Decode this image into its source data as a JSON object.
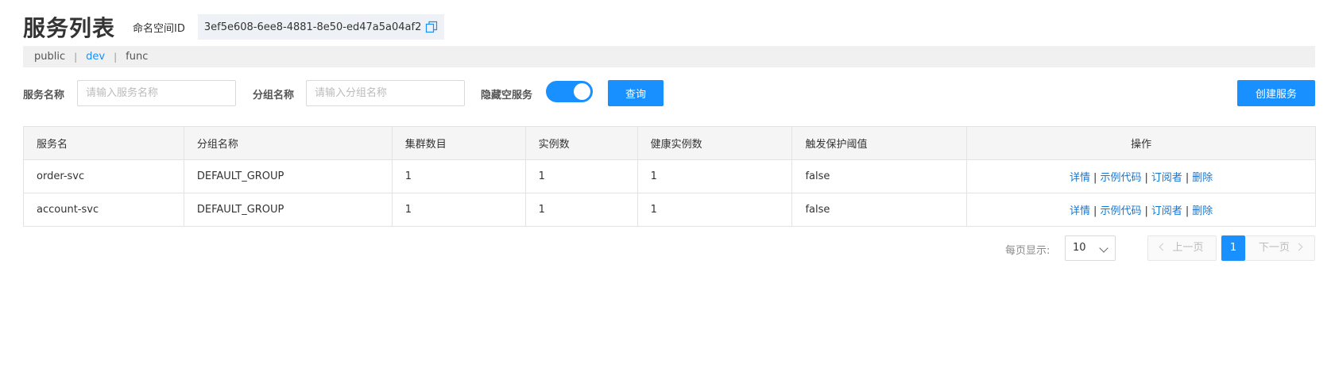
{
  "header": {
    "title": "服务列表",
    "namespace_label": "命名空间ID",
    "namespace_id": "3ef5e608-6ee8-4881-8e50-ed47a5a04af2",
    "copy_icon": "copy-icon"
  },
  "namespaces": {
    "items": [
      "public",
      "dev",
      "func"
    ],
    "active": "dev",
    "separator": "|"
  },
  "filters": {
    "service_name_label": "服务名称",
    "service_name_placeholder": "请输入服务名称",
    "service_name_value": "",
    "group_name_label": "分组名称",
    "group_name_placeholder": "请输入分组名称",
    "group_name_value": "",
    "hide_empty_label": "隐藏空服务",
    "hide_empty_on": true,
    "search_label": "查询",
    "create_label": "创建服务"
  },
  "table": {
    "columns": [
      "服务名",
      "分组名称",
      "集群数目",
      "实例数",
      "健康实例数",
      "触发保护阈值",
      "操作"
    ],
    "rows": [
      [
        "order-svc",
        "DEFAULT_GROUP",
        "1",
        "1",
        "1",
        "false"
      ],
      [
        "account-svc",
        "DEFAULT_GROUP",
        "1",
        "1",
        "1",
        "false"
      ]
    ],
    "actions": [
      "详情",
      "示例代码",
      "订阅者",
      "删除"
    ],
    "action_separator": "|"
  },
  "pagination": {
    "page_size_label": "每页显示:",
    "page_size": "10",
    "prev_label": "上一页",
    "next_label": "下一页",
    "current_page": "1"
  },
  "colors": {
    "primary": "#1890ff",
    "link": "#1677d2"
  }
}
